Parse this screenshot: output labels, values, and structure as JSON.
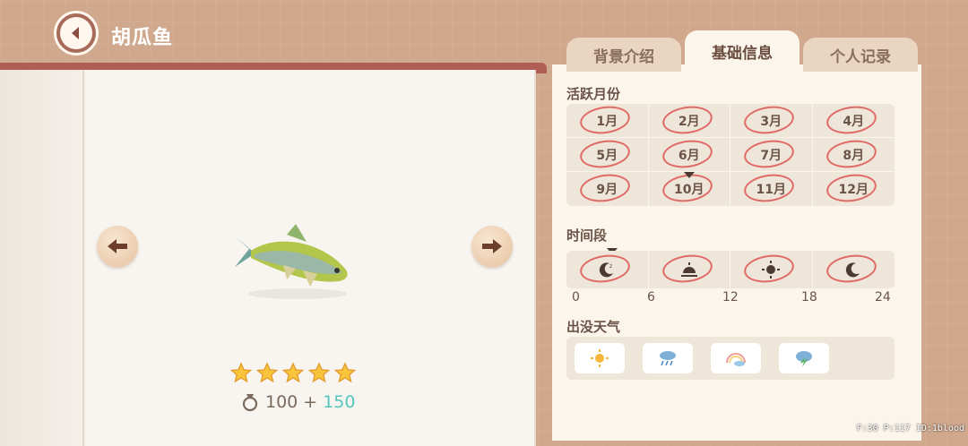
{
  "header": {
    "title": "胡瓜鱼"
  },
  "tabs": [
    {
      "label": "背景介绍",
      "active": false
    },
    {
      "label": "基础信息",
      "active": true
    },
    {
      "label": "个人记录",
      "active": false
    }
  ],
  "fish": {
    "name_icon": "smelt-fish-illustration",
    "stars": 5,
    "reward_base": "100",
    "reward_plus": "+",
    "reward_bonus": "150",
    "reward_icon": "medal-icon"
  },
  "active_months": {
    "label": "活跃月份",
    "months": [
      "1月",
      "2月",
      "3月",
      "4月",
      "5月",
      "6月",
      "7月",
      "8月",
      "9月",
      "10月",
      "11月",
      "12月"
    ],
    "all_circled": true,
    "current_month": "10月"
  },
  "time_period": {
    "label": "时间段",
    "ticks": [
      "0",
      "6",
      "12",
      "18",
      "24"
    ],
    "segments": [
      "night-icon",
      "sunrise-icon",
      "sun-icon",
      "moon-icon"
    ],
    "all_circled": true
  },
  "weather": {
    "label": "出没天气",
    "items": [
      "sunny-icon",
      "rain-icon",
      "rainbow-icon",
      "storm-icon"
    ]
  },
  "debug": {
    "text": "F:30  P:117  ID:1blood"
  },
  "colors": {
    "accent_red": "#e06a66",
    "bonus": "#56c5c0",
    "book_red": "#b05d55"
  }
}
